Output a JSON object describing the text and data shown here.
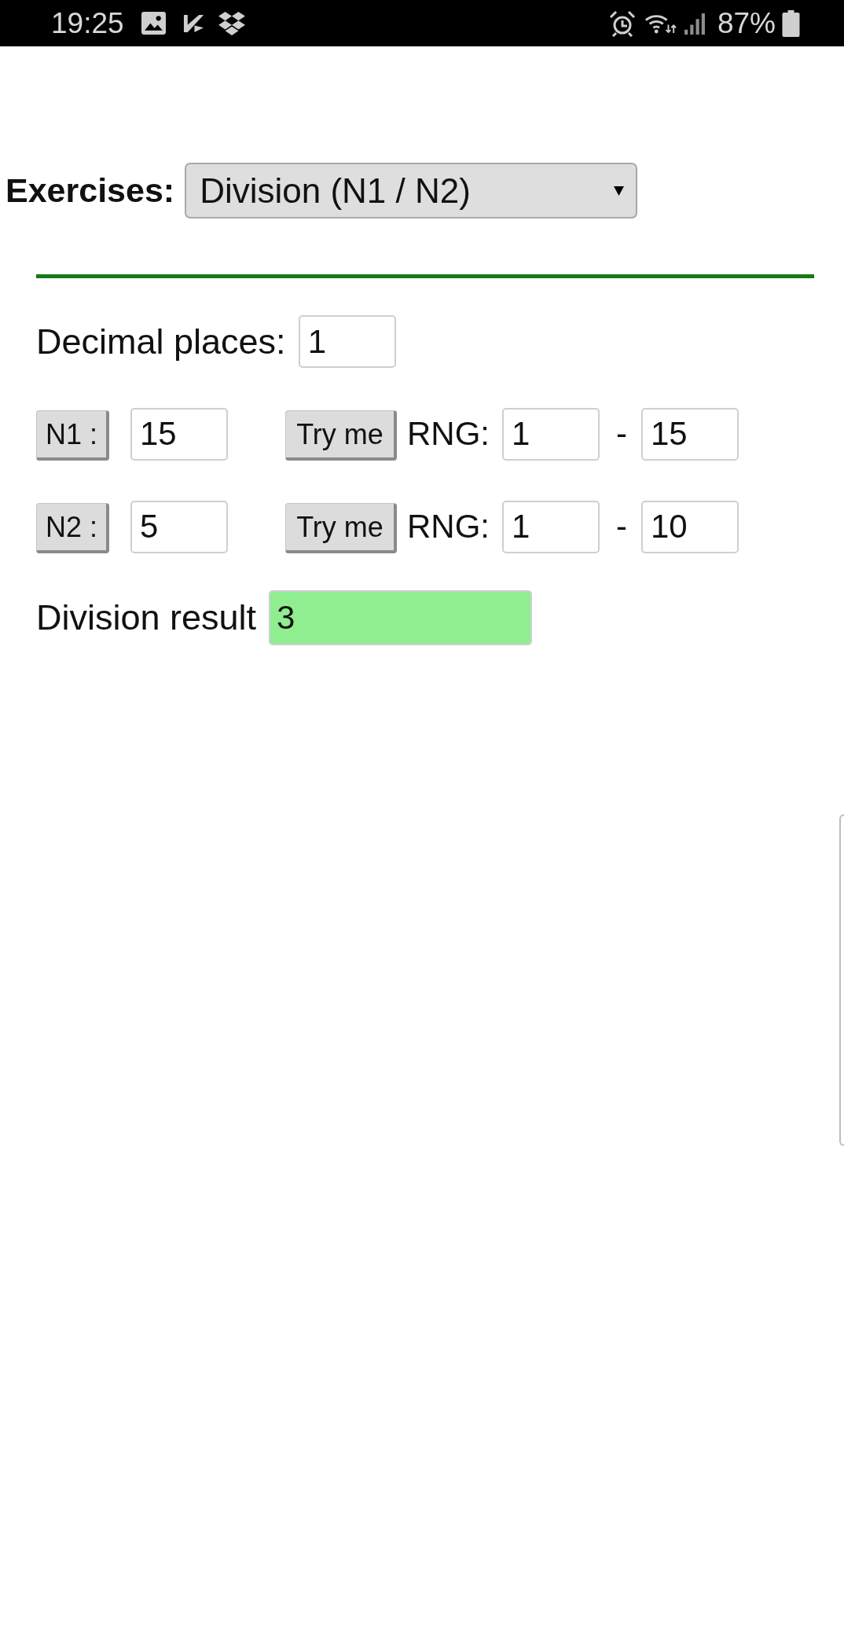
{
  "status_bar": {
    "time": "19:25",
    "battery": "87%"
  },
  "exercise_picker": {
    "label": "Exercises:",
    "value": "Division (N1 / N2)"
  },
  "decimal_places": {
    "label": "Decimal places:",
    "value": "1"
  },
  "operands": [
    {
      "button": "N1 :",
      "value": "15",
      "try_button": "Try me",
      "range_label": "RNG:",
      "range_min": "1",
      "range_separator": "-",
      "range_max": "15"
    },
    {
      "button": "N2 :",
      "value": "5",
      "try_button": "Try me",
      "range_label": "RNG:",
      "range_min": "1",
      "range_separator": "-",
      "range_max": "10"
    }
  ],
  "result": {
    "label": "Division result",
    "value": "3",
    "correct": true
  }
}
